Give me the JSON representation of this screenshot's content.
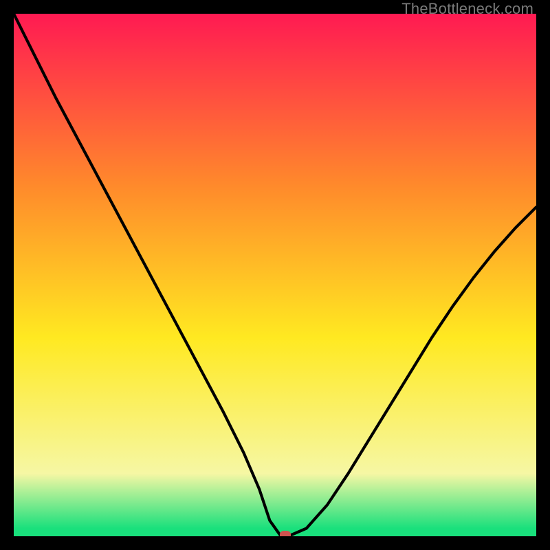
{
  "watermark": "TheBottleneck.com",
  "colors": {
    "top": "#ff1a52",
    "orange": "#ff8a2b",
    "yellow": "#ffe921",
    "pale": "#f6f7a4",
    "green": "#19e07c",
    "marker": "#d0524f",
    "frame": "#000000",
    "curve": "#000000"
  },
  "chart_data": {
    "type": "line",
    "title": "",
    "xlabel": "",
    "ylabel": "",
    "xlim": [
      0,
      100
    ],
    "ylim": [
      0,
      100
    ],
    "grid": false,
    "series": [
      {
        "name": "curve",
        "x": [
          0,
          4,
          8,
          12,
          16,
          20,
          24,
          28,
          32,
          36,
          40,
          44,
          47,
          49,
          51,
          53,
          56,
          60,
          64,
          68,
          72,
          76,
          80,
          84,
          88,
          92,
          96,
          100
        ],
        "y": [
          100,
          92,
          84,
          76.5,
          69,
          61.5,
          54,
          46.5,
          39,
          31.5,
          24,
          16,
          9,
          3,
          0.2,
          0.2,
          1.5,
          6,
          12,
          18.5,
          25,
          31.5,
          38,
          44,
          49.5,
          54.5,
          59,
          63
        ]
      }
    ],
    "marker": {
      "x": 52,
      "y": 0
    },
    "gradient_stops": [
      {
        "offset": 0.0,
        "color": "#ff1a52"
      },
      {
        "offset": 0.33,
        "color": "#ff8a2b"
      },
      {
        "offset": 0.62,
        "color": "#ffe921"
      },
      {
        "offset": 0.88,
        "color": "#f6f7a4"
      },
      {
        "offset": 0.985,
        "color": "#19e07c"
      },
      {
        "offset": 1.0,
        "color": "#19e07c"
      }
    ]
  }
}
